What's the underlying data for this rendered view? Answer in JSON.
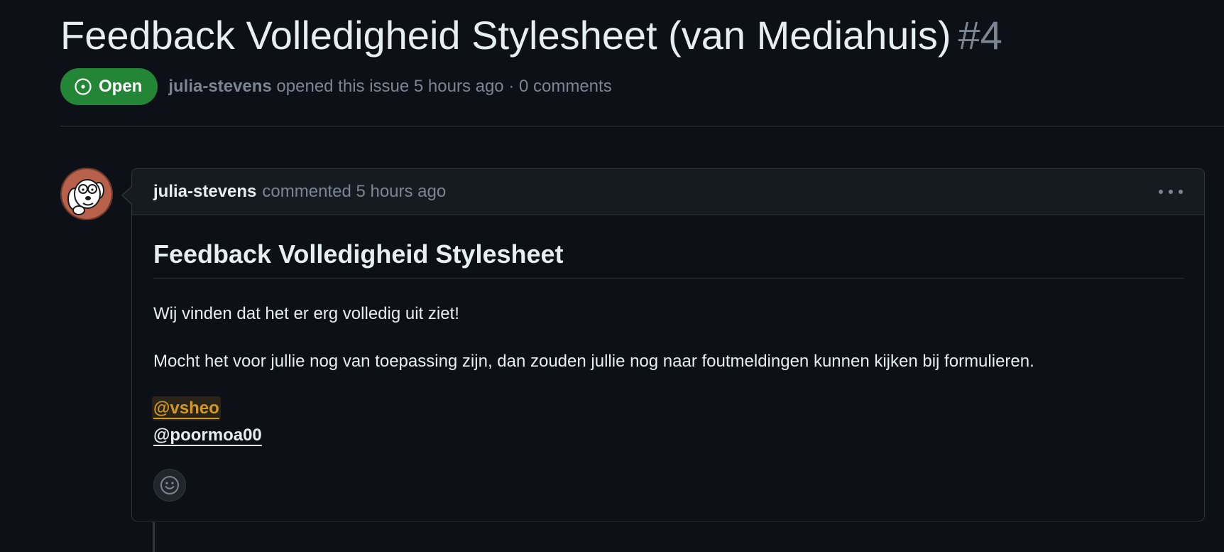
{
  "issue": {
    "title": "Feedback Volledigheid Stylesheet (van Mediahuis)",
    "number": "#4",
    "state": "Open",
    "author": "julia-stevens",
    "opened_text": "opened this issue 5 hours ago · 0 comments"
  },
  "comment": {
    "author": "julia-stevens",
    "action_text": "commented 5 hours ago",
    "heading": "Feedback Volledigheid Stylesheet",
    "paragraph_1": "Wij vinden dat het er erg volledig uit ziet!",
    "paragraph_2": "Mocht het voor jullie nog van toepassing zijn, dan zouden jullie nog naar foutmeldingen kunnen kijken bij formulieren.",
    "mentions": [
      "@vsheo",
      "@poormoa00"
    ]
  },
  "icons": {
    "state": "issue-opened-icon",
    "menu": "kebab-horizontal-icon",
    "reaction": "smiley-icon",
    "avatar": "cartoon-dog-avatar"
  },
  "colors": {
    "background": "#0d1117",
    "open_badge": "#238636",
    "mention_highlight": "#d29922",
    "muted_text": "#7d8590",
    "border": "#30363d"
  }
}
